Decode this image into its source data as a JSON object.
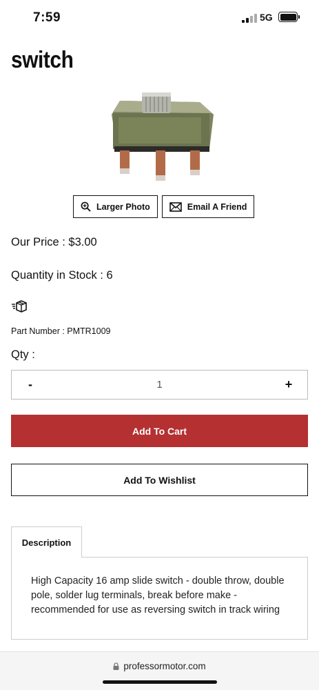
{
  "status": {
    "time": "7:59",
    "network": "5G"
  },
  "product": {
    "title": "switch",
    "image_name": "slide-switch-photo",
    "buttons": {
      "larger_photo": "Larger Photo",
      "email_friend": "Email A Friend"
    },
    "price": "Our Price : $3.00",
    "stock": "Quantity in Stock : 6",
    "part_number": "Part Number : PMTR1009"
  },
  "quantity": {
    "label": "Qty :",
    "minus": "-",
    "value": "1",
    "plus": "+"
  },
  "actions": {
    "add_to_cart": "Add To Cart",
    "add_to_wishlist": "Add To Wishlist",
    "cart_color": "#b53031"
  },
  "tabs": {
    "description": "Description"
  },
  "description": {
    "text": "High Capacity 16 amp slide switch - double throw, double pole, solder lug terminals, break before make - recommended for use as reversing switch in track wiring"
  },
  "browser": {
    "url": "professormotor.com"
  }
}
